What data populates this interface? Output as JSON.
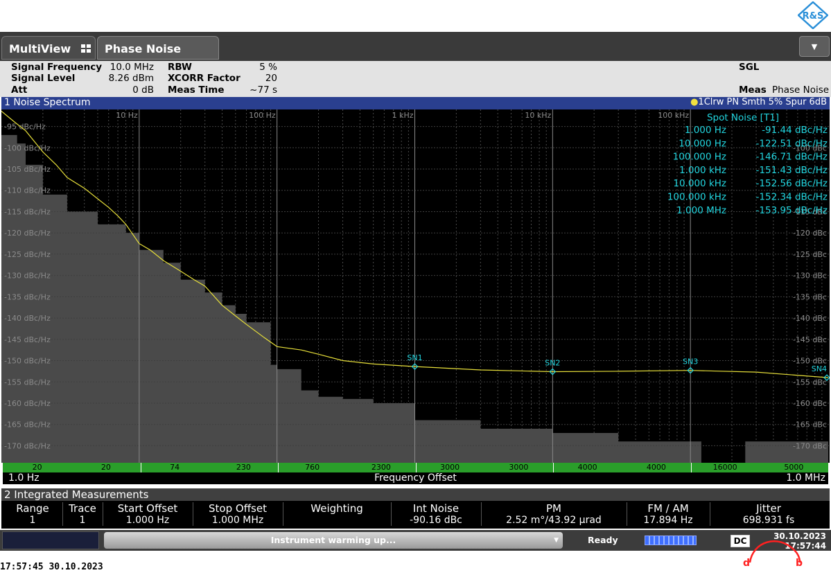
{
  "brand": {
    "logo_text": "R&S"
  },
  "tabs": [
    {
      "label": "MultiView"
    },
    {
      "label": "Phase Noise"
    }
  ],
  "settings": {
    "signal_frequency_label": "Signal Frequency",
    "signal_frequency_value": "10.0 MHz",
    "signal_level_label": "Signal Level",
    "signal_level_value": "8.26 dBm",
    "att_label": "Att",
    "att_value": "0 dB",
    "rbw_label": "RBW",
    "rbw_value": "5 %",
    "xcorr_label": "XCORR Factor",
    "xcorr_value": "20",
    "meas_time_label": "Meas Time",
    "meas_time_value": "~77 s",
    "sgl": "SGL",
    "meas_label": "Meas",
    "meas_value": "Phase Noise"
  },
  "window1": {
    "title": "1 Noise Spectrum",
    "trace_info": "1Clrw PN Smth 5% Spur 6dB",
    "spot_noise_title": "Spot Noise [T1]",
    "spot_noise": [
      {
        "freq": "1.000 Hz",
        "value": "-91.44 dBc/Hz"
      },
      {
        "freq": "10.000 Hz",
        "value": "-122.51 dBc/Hz"
      },
      {
        "freq": "100.000 Hz",
        "value": "-146.71 dBc/Hz"
      },
      {
        "freq": "1.000 kHz",
        "value": "-151.43 dBc/Hz"
      },
      {
        "freq": "10.000 kHz",
        "value": "-152.56 dBc/Hz"
      },
      {
        "freq": "100.000 kHz",
        "value": "-152.34 dBc/Hz"
      },
      {
        "freq": "1.000 MHz",
        "value": "-153.95 dBc/Hz"
      }
    ],
    "x_start": "1.0 Hz",
    "x_stop": "1.0 MHz",
    "x_label": "Frequency Offset",
    "range_counts": [
      "20",
      "20",
      "74",
      "230",
      "760",
      "2300",
      "3000",
      "3000",
      "4000",
      "4000",
      "16000",
      "5000"
    ]
  },
  "chart_data": {
    "type": "line",
    "title": "1 Noise Spectrum",
    "xlabel": "Frequency Offset",
    "ylabel": "",
    "x_scale": "log",
    "xlim": [
      1,
      1000000
    ],
    "ylim": [
      -174,
      -91
    ],
    "x_tick_labels": [
      "10 Hz",
      "100 Hz",
      "1 kHz",
      "10 kHz",
      "100 kHz"
    ],
    "x_tick_values": [
      10,
      100,
      1000,
      10000,
      100000
    ],
    "y_tick_labels_left": [
      "-95 dBc/Hz",
      "-100 dBc/Hz",
      "-105 dBc/Hz",
      "-110 dBc/Hz",
      "-115 dBc/Hz",
      "-120 dBc/Hz",
      "-125 dBc/Hz",
      "-130 dBc/Hz",
      "-135 dBc/Hz",
      "-140 dBc/Hz",
      "-145 dBc/Hz",
      "-150 dBc/Hz",
      "-155 dBc/Hz",
      "-160 dBc/Hz",
      "-165 dBc/Hz",
      "-170 dBc/Hz"
    ],
    "y_tick_labels_right": [
      "-100 dBc",
      "-115 dBc",
      "-120 dBc",
      "-125 dBc",
      "-130 dBc",
      "-135 dBc",
      "-140 dBc",
      "-145 dBc",
      "-150 dBc",
      "-155 dBc",
      "-160 dBc",
      "-165 dBc",
      "-170 dBc"
    ],
    "y_tick_values": [
      -95,
      -100,
      -105,
      -110,
      -115,
      -120,
      -125,
      -130,
      -135,
      -140,
      -145,
      -150,
      -155,
      -160,
      -165,
      -170
    ],
    "y_tick_values_right": [
      -100,
      -115,
      -120,
      -125,
      -130,
      -135,
      -140,
      -145,
      -150,
      -155,
      -160,
      -165,
      -170
    ],
    "grid": true,
    "colors": {
      "trace": "#e8e03a",
      "marker": "#22d6e0",
      "floor": "#4a4a4a",
      "background": "#000000"
    },
    "series": [
      {
        "name": "1Clrw PN Smth 5% Spur 6dB",
        "x": [
          1,
          1.25,
          1.5,
          2,
          2.5,
          3,
          4,
          5,
          6,
          7,
          8,
          10,
          12,
          15,
          20,
          25,
          30,
          40,
          50,
          60,
          80,
          100,
          150,
          200,
          300,
          500,
          1000,
          3000,
          10000,
          30000,
          100000,
          300000,
          1000000
        ],
        "y": [
          -91.4,
          -94,
          -96,
          -101,
          -104,
          -107,
          -109.5,
          -112,
          -114,
          -116,
          -118,
          -122.5,
          -124,
          -126.5,
          -129,
          -131,
          -132.5,
          -137,
          -139.5,
          -141.5,
          -144.5,
          -146.7,
          -147.5,
          -148.5,
          -150,
          -150.8,
          -151.4,
          -152.2,
          -152.6,
          -152.5,
          -152.3,
          -152.7,
          -154
        ]
      }
    ],
    "noise_floor": {
      "x": [
        1,
        1.3,
        1.5,
        2,
        3,
        5,
        8,
        10,
        15,
        20,
        30,
        40,
        50,
        60,
        90,
        100,
        150,
        200,
        300,
        500,
        1000,
        3000,
        10000,
        30000,
        100000,
        120000,
        200000,
        250000,
        1000000
      ],
      "y": [
        -97,
        -99,
        -104,
        -111,
        -115,
        -118,
        -120,
        -124,
        -127,
        -131,
        -134,
        -137,
        -139,
        -141,
        -151,
        -152,
        -157,
        -158.5,
        -159,
        -160,
        -164,
        -166,
        -167,
        -169,
        -169,
        -174,
        -174,
        -169,
        -169
      ]
    },
    "markers": [
      {
        "label": "SN1",
        "x": 1000,
        "y": -151.4
      },
      {
        "label": "SN2",
        "x": 10000,
        "y": -152.6
      },
      {
        "label": "SN3",
        "x": 100000,
        "y": -152.3
      },
      {
        "label": "SN4",
        "x": 1000000,
        "y": -154
      }
    ]
  },
  "window2": {
    "title": "2 Integrated Measurements",
    "headers": [
      "Range",
      "Trace",
      "Start Offset",
      "Stop Offset",
      "Weighting",
      "Int Noise",
      "PM",
      "FM / AM",
      "Jitter"
    ],
    "row": [
      "1",
      "1",
      "1.000 Hz",
      "1.000 MHz",
      "",
      "-90.16 dBc",
      "2.52 m°/43.92 µrad",
      "17.894 Hz",
      "698.931 fs"
    ]
  },
  "statusbar": {
    "message": "Instrument warming up...",
    "ready": "Ready",
    "dc": "DC",
    "date": "30.10.2023",
    "time": "17:57:44"
  },
  "footer": {
    "clock": "17:57:45   30.10.2023"
  }
}
